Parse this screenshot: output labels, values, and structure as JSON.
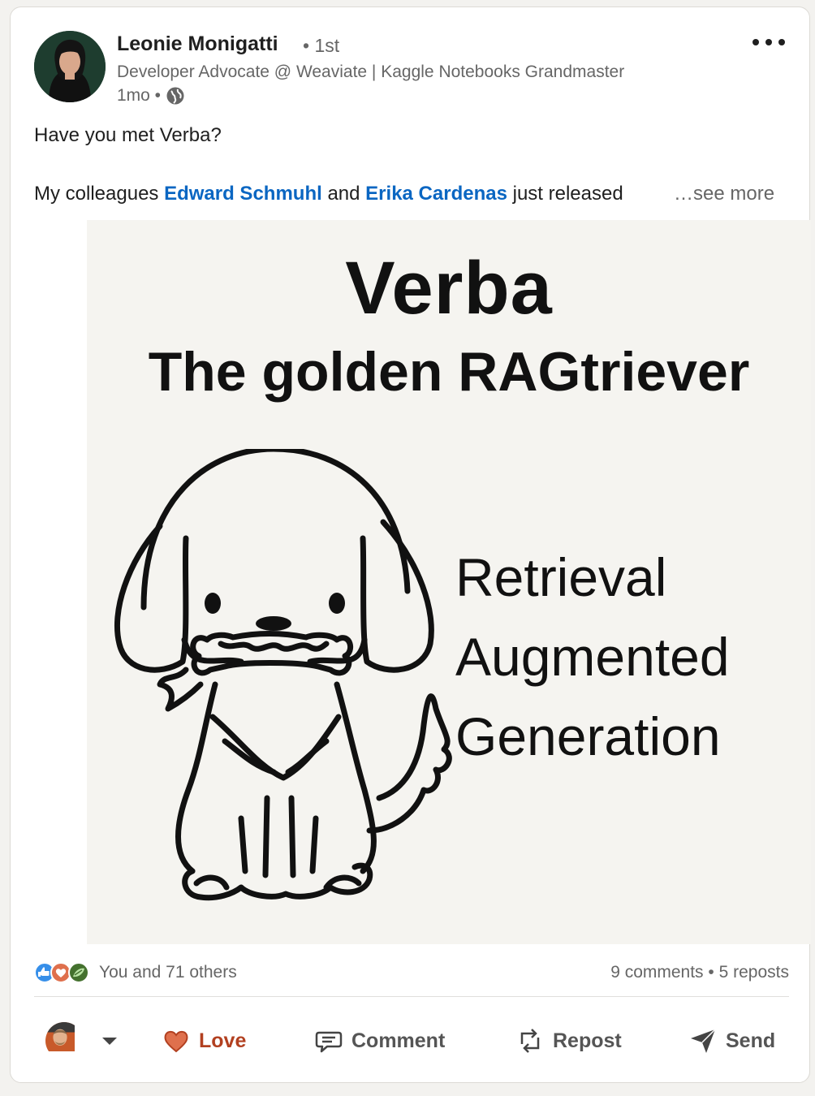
{
  "post": {
    "author": {
      "name": "Leonie Monigatti",
      "degree": "• 1st",
      "headline": "Developer Advocate @ Weaviate | Kaggle Notebooks Grandmaster",
      "time": "1mo •",
      "visibility_icon": "globe-icon"
    },
    "text": {
      "line1": "Have you met Verba?",
      "line2_prefix": "My colleagues ",
      "mention1": "Edward Schmuhl",
      "line2_middle": " and ",
      "mention2": "Erika Cardenas",
      "line2_suffix": " just released",
      "see_more": "…see more"
    },
    "image": {
      "title": "Verba",
      "subtitle": "The golden RAGtriever",
      "words": [
        "Retrieval",
        "Augmented",
        "Generation"
      ]
    },
    "social": {
      "reactions_label": "You and 71 others",
      "comments": "9 comments",
      "separator": "•",
      "reposts": "5 reposts",
      "reaction_icons": [
        "like-icon",
        "love-icon",
        "insightful-icon"
      ]
    },
    "actions": {
      "love": "Love",
      "comment": "Comment",
      "repost": "Repost",
      "send": "Send"
    }
  },
  "colors": {
    "link": "#0a66c2",
    "love": "#b24020",
    "muted": "#666666"
  }
}
